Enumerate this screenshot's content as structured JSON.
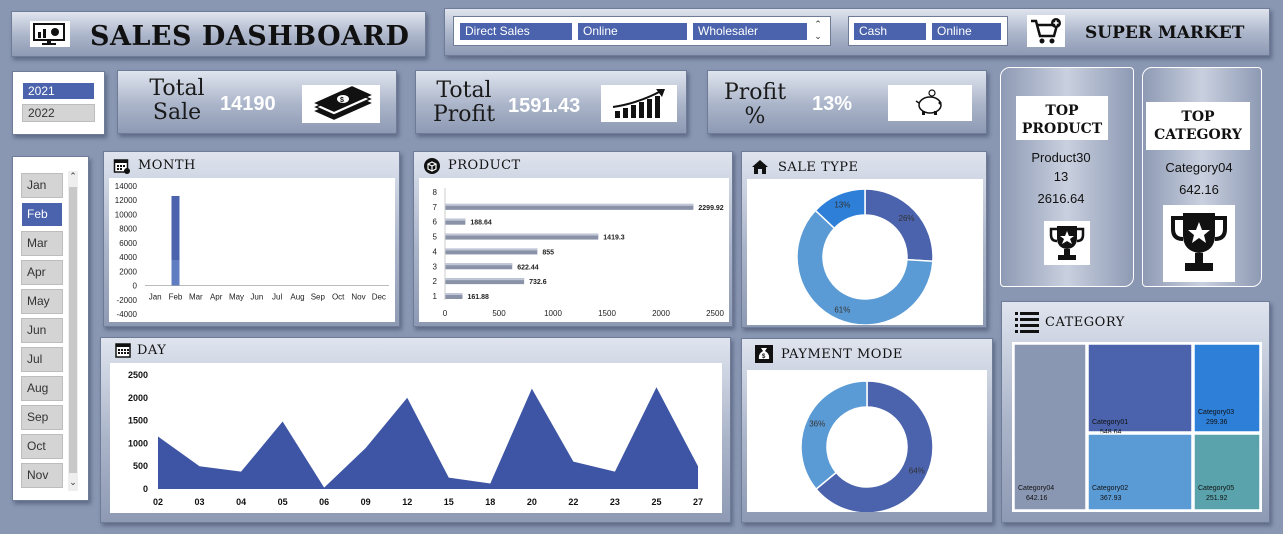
{
  "header": {
    "title": "SALES DASHBOARD",
    "brand": "SUPER MARKET"
  },
  "sale_type_slicer": [
    "Direct Sales",
    "Online",
    "Wholesaler"
  ],
  "payment_slicer": [
    "Cash",
    "Online"
  ],
  "year_slicer": [
    {
      "label": "2021",
      "selected": true
    },
    {
      "label": "2022",
      "selected": false
    }
  ],
  "kpis": {
    "total_sale": {
      "label_line1": "Total",
      "label_line2": "Sale",
      "value": "14190"
    },
    "total_profit": {
      "label_line1": "Total",
      "label_line2": "Profit",
      "value": "1591.43"
    },
    "profit_pct": {
      "label_line1": "Profit",
      "label_line2": "%",
      "value": "13%"
    }
  },
  "month_slicer": [
    {
      "label": "Jan",
      "selected": false
    },
    {
      "label": "Feb",
      "selected": true
    },
    {
      "label": "Mar",
      "selected": false
    },
    {
      "label": "Apr",
      "selected": false
    },
    {
      "label": "May",
      "selected": false
    },
    {
      "label": "Jun",
      "selected": false
    },
    {
      "label": "Jul",
      "selected": false
    },
    {
      "label": "Aug",
      "selected": false
    },
    {
      "label": "Sep",
      "selected": false
    },
    {
      "label": "Oct",
      "selected": false
    },
    {
      "label": "Nov",
      "selected": false
    }
  ],
  "top_product": {
    "title_line1": "TOP",
    "title_line2": "PRODUCT",
    "name": "Product30",
    "qty": "13",
    "value": "2616.64"
  },
  "top_category": {
    "title_line1": "TOP",
    "title_line2": "CATEGORY",
    "name": "Category04",
    "value": "642.16"
  },
  "panels": {
    "month": "MONTH",
    "product": "PRODUCT",
    "sale_type": "SALE TYPE",
    "day": "DAY",
    "payment_mode": "PAYMENT MODE",
    "category": "CATEGORY"
  },
  "colors": {
    "dark_blue": "#4a63ac",
    "mid_blue": "#5b9bd5",
    "bright_blue": "#2e7fd8",
    "teal": "#5aa3ad",
    "grey_blue": "#8a97b3"
  },
  "chart_data": [
    {
      "id": "month",
      "type": "bar",
      "categories": [
        "Jan",
        "Feb",
        "Mar",
        "Apr",
        "May",
        "Jun",
        "Jul",
        "Aug",
        "Sep",
        "Oct",
        "Nov",
        "Dec"
      ],
      "values": [
        0,
        12600,
        0,
        0,
        0,
        0,
        0,
        0,
        0,
        0,
        0,
        0
      ],
      "ylim": [
        -4000,
        14000
      ],
      "yticks": [
        "14000",
        "12000",
        "10000",
        "8000",
        "6000",
        "4000",
        "2000",
        "0",
        "-2000",
        "-4000"
      ]
    },
    {
      "id": "product",
      "type": "bar",
      "orientation": "horizontal",
      "categories": [
        "1",
        "2",
        "3",
        "4",
        "5",
        "6",
        "7",
        "8"
      ],
      "values": [
        161.88,
        732.6,
        622.44,
        855,
        1419.3,
        188.64,
        2299.92,
        null
      ],
      "labels": [
        "161.88",
        "732.6",
        "622.44",
        "855",
        "1419.3",
        "188.64",
        "2299.92",
        ""
      ],
      "xlim": [
        0,
        2500
      ],
      "xticks": [
        "0",
        "500",
        "1000",
        "1500",
        "2000",
        "2500"
      ]
    },
    {
      "id": "sale_type",
      "type": "pie",
      "donut": true,
      "slices": [
        {
          "value": 26,
          "label": "26%",
          "color": "#4a63ac"
        },
        {
          "value": 61,
          "label": "61%",
          "color": "#5b9bd5"
        },
        {
          "value": 13,
          "label": "13%",
          "color": "#2e7fd8"
        }
      ]
    },
    {
      "id": "day",
      "type": "area",
      "categories": [
        "02",
        "03",
        "04",
        "05",
        "06",
        "09",
        "12",
        "15",
        "18",
        "20",
        "22",
        "23",
        "25",
        "27"
      ],
      "values": [
        1150,
        500,
        380,
        1480,
        30,
        900,
        2000,
        250,
        120,
        2200,
        600,
        380,
        2230,
        500
      ],
      "ylim": [
        0,
        2500
      ],
      "yticks": [
        "2500",
        "2000",
        "1500",
        "1000",
        "500",
        "0"
      ]
    },
    {
      "id": "payment_mode",
      "type": "pie",
      "donut": true,
      "slices": [
        {
          "value": 64,
          "label": "64%",
          "color": "#4a63ac"
        },
        {
          "value": 36,
          "label": "36%",
          "color": "#5b9bd5"
        }
      ]
    },
    {
      "id": "category",
      "type": "heatmap",
      "cells": [
        {
          "name": "Category04",
          "value": "642.16",
          "color": "#8a97b3"
        },
        {
          "name": "Category01",
          "value": "548.64",
          "color": "#4a63ac"
        },
        {
          "name": "Category02",
          "value": "367.93",
          "color": "#5b9bd5"
        },
        {
          "name": "Category03",
          "value": "299.36",
          "color": "#2e7fd8"
        },
        {
          "name": "Category05",
          "value": "251.92",
          "color": "#5aa3ad"
        }
      ]
    }
  ]
}
